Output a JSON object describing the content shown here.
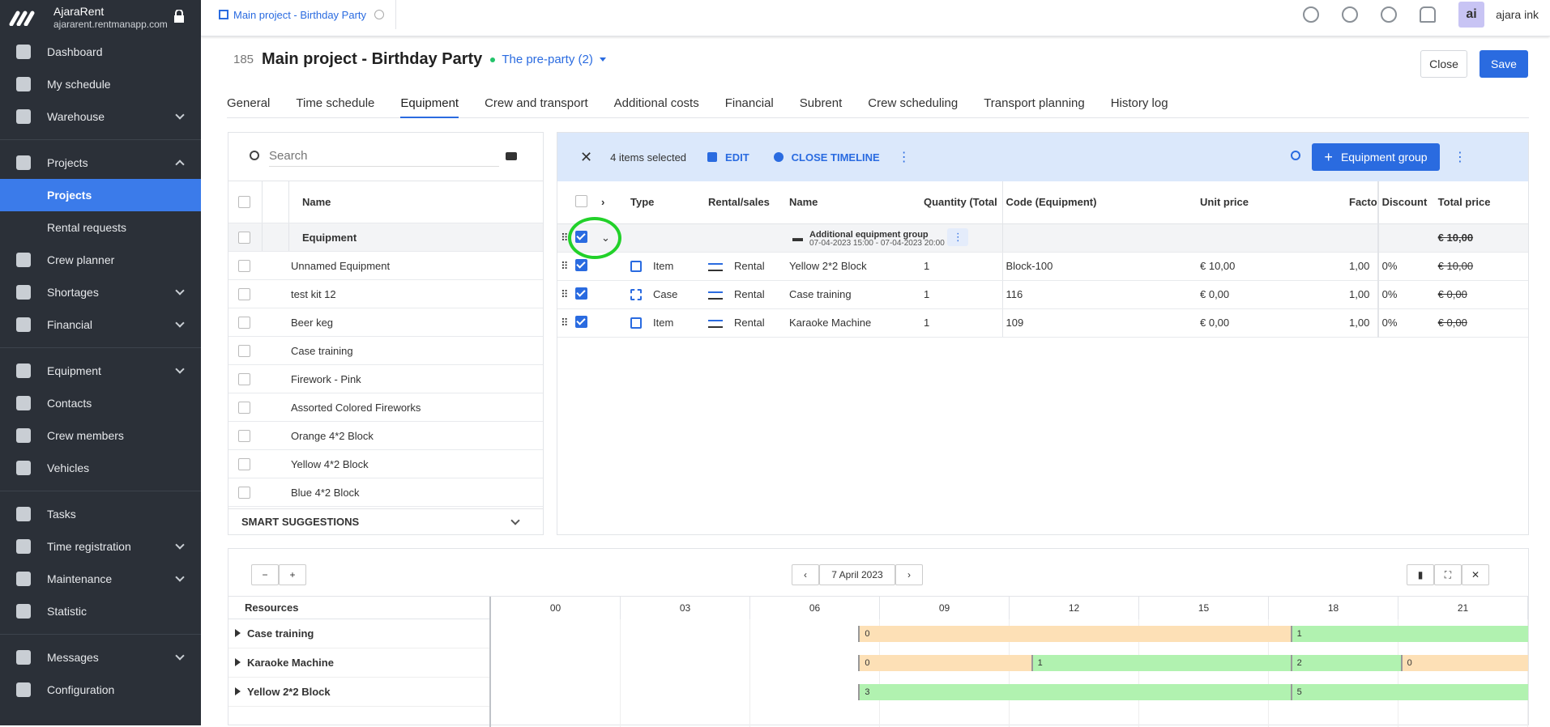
{
  "app": {
    "name": "AjaraRent",
    "url": "ajararent.rentmanapp.com"
  },
  "sidebar": {
    "items": [
      {
        "label": "Dashboard"
      },
      {
        "label": "My schedule"
      },
      {
        "label": "Warehouse"
      },
      {
        "label": "Projects"
      },
      {
        "label": "Projects"
      },
      {
        "label": "Rental requests"
      },
      {
        "label": "Crew planner"
      },
      {
        "label": "Shortages"
      },
      {
        "label": "Financial"
      },
      {
        "label": "Equipment"
      },
      {
        "label": "Contacts"
      },
      {
        "label": "Crew members"
      },
      {
        "label": "Vehicles"
      },
      {
        "label": "Tasks"
      },
      {
        "label": "Time registration"
      },
      {
        "label": "Maintenance"
      },
      {
        "label": "Statistic"
      },
      {
        "label": "Messages"
      },
      {
        "label": "Configuration"
      }
    ]
  },
  "topbar": {
    "doc_tab": "Main project - Birthday Party",
    "avatar": "ai",
    "user": "ajara ink"
  },
  "project": {
    "number": "185",
    "title": "Main project - Birthday Party",
    "subproject": "The pre-party (2)"
  },
  "buttons": {
    "close": "Close",
    "save": "Save"
  },
  "tabs": [
    "General",
    "Time schedule",
    "Equipment",
    "Crew and transport",
    "Additional costs",
    "Financial",
    "Subrent",
    "Crew scheduling",
    "Transport planning",
    "History log"
  ],
  "left": {
    "search_placeholder": "Search",
    "col_name": "Name",
    "group": "Equipment",
    "items": [
      "Unnamed Equipment",
      "test kit 12",
      "Beer keg",
      "Case training",
      "Firework - Pink",
      "Assorted Colored Fireworks",
      "Orange 4*2 Block",
      "Yellow 4*2 Block",
      "Blue 4*2 Block"
    ],
    "smart": "SMART SUGGESTIONS"
  },
  "selection": {
    "close": "✕",
    "count": "4 items selected",
    "edit": "EDIT",
    "close_timeline": "CLOSE TIMELINE",
    "equipment_group": "Equipment group",
    "plus": "+"
  },
  "grid": {
    "headers": [
      "Type",
      "Rental/sales",
      "Name",
      "Quantity (Total",
      "Code (Equipment)",
      "Unit price",
      "Facto",
      "Discount",
      "Total price"
    ],
    "group": {
      "name": "Additional equipment group",
      "dates": "07-04-2023 15:00 - 07-04-2023 20:00",
      "total": "€ 10,00"
    },
    "rows": [
      {
        "type": "Item",
        "rental": "Rental",
        "name": "Yellow 2*2 Block",
        "qty": "1",
        "code": "Block-100",
        "unit": "€ 10,00",
        "factor": "1,00",
        "discount": "0%",
        "total": "€ 10,00"
      },
      {
        "type": "Case",
        "rental": "Rental",
        "name": "Case training",
        "qty": "1",
        "code": "116",
        "unit": "€ 0,00",
        "factor": "1,00",
        "discount": "0%",
        "total": "€ 0,00"
      },
      {
        "type": "Item",
        "rental": "Rental",
        "name": "Karaoke Machine",
        "qty": "1",
        "code": "109",
        "unit": "€ 0,00",
        "factor": "1,00",
        "discount": "0%",
        "total": "€ 0,00"
      }
    ]
  },
  "timeline": {
    "minus": "−",
    "plus": "+",
    "prev": "‹",
    "next": "›",
    "date": "7 April 2023",
    "close": "✕",
    "resources_label": "Resources",
    "hours": [
      "00",
      "03",
      "06",
      "09",
      "12",
      "15",
      "18",
      "21"
    ],
    "resources": [
      {
        "name": "Case training",
        "bars": [
          {
            "v": "0",
            "start": 8.5,
            "end": 18.5,
            "c": "o"
          },
          {
            "v": "1",
            "start": 18.5,
            "end": 24,
            "c": "g"
          }
        ]
      },
      {
        "name": "Karaoke Machine",
        "bars": [
          {
            "v": "0",
            "start": 8.5,
            "end": 12.5,
            "c": "o"
          },
          {
            "v": "1",
            "start": 12.5,
            "end": 18.5,
            "c": "g"
          },
          {
            "v": "2",
            "start": 18.5,
            "end": 21.05,
            "c": "g"
          },
          {
            "v": "0",
            "start": 21.05,
            "end": 24,
            "c": "o"
          }
        ]
      },
      {
        "name": "Yellow 2*2 Block",
        "bars": [
          {
            "v": "3",
            "start": 8.5,
            "end": 18.5,
            "c": "g"
          },
          {
            "v": "5",
            "start": 18.5,
            "end": 24,
            "c": "g"
          }
        ]
      }
    ]
  }
}
